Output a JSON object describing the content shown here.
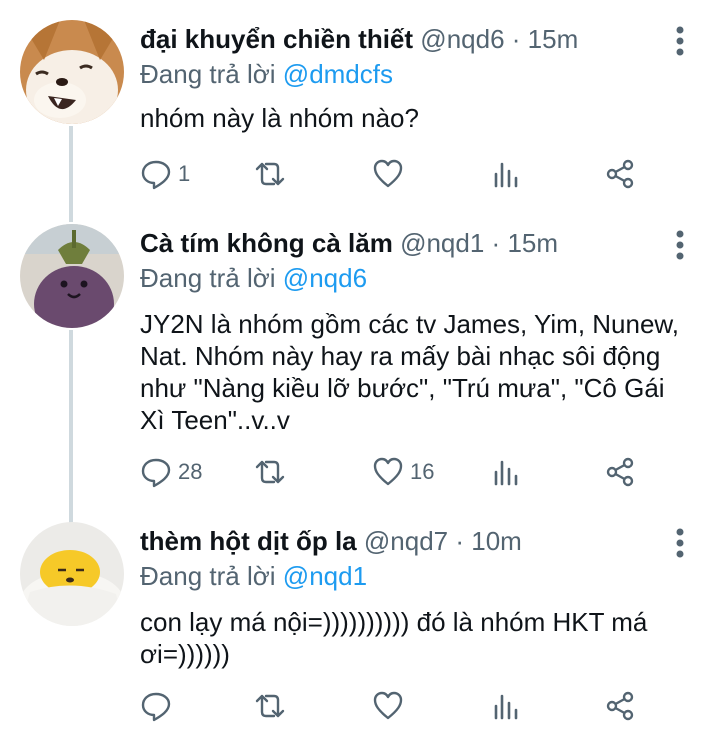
{
  "tweets": [
    {
      "name": "đại khuyển chiền thiết",
      "handle": "@nqd6",
      "time": "15m",
      "reply_label": "Đang trả lời",
      "reply_to": "@dmdcfs",
      "text": "nhóm này là nhóm nào?",
      "replies": "1",
      "retweets": "",
      "likes": "",
      "avatar": "shiba-dog"
    },
    {
      "name": "Cà tím không cà lăm",
      "handle": "@nqd1",
      "time": "15m",
      "reply_label": "Đang trả lời",
      "reply_to": "@nqd6",
      "text": "JY2N là nhóm gồm các tv James, Yim, Nunew, Nat. Nhóm này hay ra mấy bài nhạc sôi động như \"Nàng kiều lỡ bước\", \"Trú mưa\", \"Cô Gái Xì Teen\"..v..v",
      "replies": "28",
      "retweets": "",
      "likes": "16",
      "avatar": "eggplant-plush"
    },
    {
      "name": "thèm hột dịt ốp la",
      "handle": "@nqd7",
      "time": "10m",
      "reply_label": "Đang trả lời",
      "reply_to": "@nqd1",
      "text": "con lạy má nội=)))))))))) đó là nhóm HKT má ơi=))))))",
      "replies": "",
      "retweets": "",
      "likes": "",
      "avatar": "gudetama-egg"
    }
  ],
  "separator": "·",
  "colors": {
    "text": "#0f1419",
    "secondary": "#536471",
    "link": "#1d9bf0",
    "thread": "#cfd9de"
  }
}
